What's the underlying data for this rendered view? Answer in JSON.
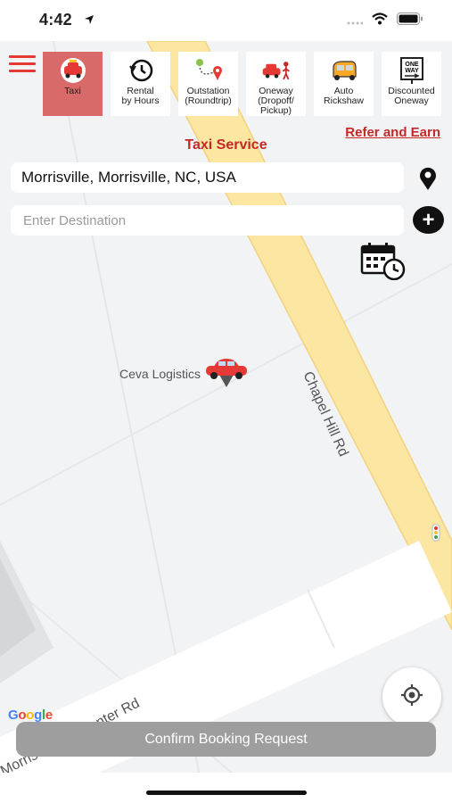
{
  "status": {
    "time": "4:42"
  },
  "services": [
    {
      "label": "Taxi",
      "icon": "taxi-icon",
      "active": true
    },
    {
      "label": "Rental\nby Hours",
      "icon": "clock-history-icon",
      "active": false
    },
    {
      "label": "Outstation\n(Roundtrip)",
      "icon": "route-icon",
      "active": false
    },
    {
      "label": "Oneway\n(Dropoff/\nPickup)",
      "icon": "car-person-icon",
      "active": false
    },
    {
      "label": "Auto\nRickshaw",
      "icon": "rickshaw-icon",
      "active": false
    },
    {
      "label": "Discounted\nOneway",
      "icon": "oneway-sign-icon",
      "active": false
    }
  ],
  "header": {
    "title": "Taxi Service",
    "refer_label": "Refer and Earn"
  },
  "pickup": {
    "value": "Morrisville, Morrisville, NC, USA"
  },
  "destination": {
    "placeholder": "Enter Destination",
    "value": ""
  },
  "map": {
    "poi_label": "Ceva Logistics",
    "road_chapel": "Chapel Hill Rd",
    "road_carpenter": "Morrisville Carpenter Rd",
    "google_label": "Google"
  },
  "confirm_label": "Confirm Booking Request",
  "colors": {
    "accent": "#c62828",
    "active_tile": "#d96a6a",
    "road_yellow": "#fbe6a2"
  }
}
